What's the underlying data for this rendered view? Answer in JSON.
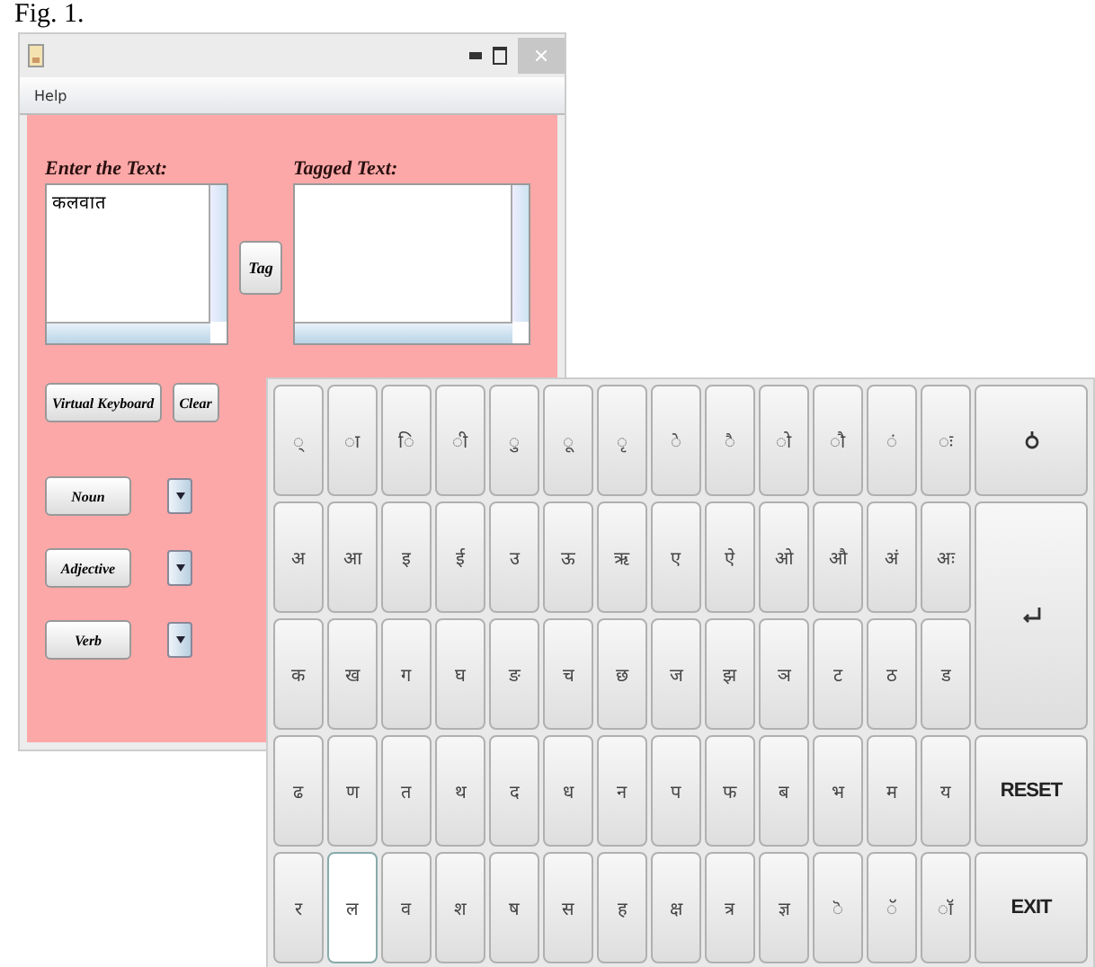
{
  "caption": "Fig. 1.",
  "window": {
    "menu": [
      "Help"
    ]
  },
  "input_label": "Enter the Text:",
  "input_value": "कलवात",
  "output_label": "Tagged Text:",
  "tag_button": "Tag",
  "buttons": [
    "Virtual Keyboard",
    "Clear"
  ],
  "tag_rows": [
    {
      "label": "Noun"
    },
    {
      "label": "Adjective"
    },
    {
      "label": "Verb"
    }
  ],
  "keyboard": {
    "rows": [
      [
        {
          "label": "्",
          "selected": false
        },
        {
          "label": "ा",
          "selected": false
        },
        {
          "label": "ि",
          "selected": false
        },
        {
          "label": "ी",
          "selected": false
        },
        {
          "label": "ु",
          "selected": false
        },
        {
          "label": "ू",
          "selected": false
        },
        {
          "label": "ृ",
          "selected": false
        },
        {
          "label": "े",
          "selected": false
        },
        {
          "label": "ै",
          "selected": false
        },
        {
          "label": "ो",
          "selected": false
        },
        {
          "label": "ौ",
          "selected": false
        },
        {
          "label": "ं",
          "selected": false
        },
        {
          "label": "ः",
          "selected": false
        }
      ],
      [
        {
          "label": "अ",
          "selected": false
        },
        {
          "label": "आ",
          "selected": false
        },
        {
          "label": "इ",
          "selected": false
        },
        {
          "label": "ई",
          "selected": false
        },
        {
          "label": "उ",
          "selected": false
        },
        {
          "label": "ऊ",
          "selected": false
        },
        {
          "label": "ऋ",
          "selected": false
        },
        {
          "label": "ए",
          "selected": false
        },
        {
          "label": "ऐ",
          "selected": false
        },
        {
          "label": "ओ",
          "selected": false
        },
        {
          "label": "औ",
          "selected": false
        },
        {
          "label": "अं",
          "selected": false
        },
        {
          "label": "अः",
          "selected": false
        }
      ],
      [
        {
          "label": "क",
          "selected": false
        },
        {
          "label": "ख",
          "selected": false
        },
        {
          "label": "ग",
          "selected": false
        },
        {
          "label": "घ",
          "selected": false
        },
        {
          "label": "ङ",
          "selected": false
        },
        {
          "label": "च",
          "selected": false
        },
        {
          "label": "छ",
          "selected": false
        },
        {
          "label": "ज",
          "selected": false
        },
        {
          "label": "झ",
          "selected": false
        },
        {
          "label": "ञ",
          "selected": false
        },
        {
          "label": "ट",
          "selected": false
        },
        {
          "label": "ठ",
          "selected": false
        },
        {
          "label": "ड",
          "selected": false
        }
      ],
      [
        {
          "label": "ढ",
          "selected": false
        },
        {
          "label": "ण",
          "selected": false
        },
        {
          "label": "त",
          "selected": false
        },
        {
          "label": "थ",
          "selected": false
        },
        {
          "label": "द",
          "selected": false
        },
        {
          "label": "ध",
          "selected": false
        },
        {
          "label": "न",
          "selected": false
        },
        {
          "label": "प",
          "selected": false
        },
        {
          "label": "फ",
          "selected": false
        },
        {
          "label": "ब",
          "selected": false
        },
        {
          "label": "भ",
          "selected": false
        },
        {
          "label": "म",
          "selected": false
        },
        {
          "label": "य",
          "selected": false
        }
      ],
      [
        {
          "label": "र",
          "selected": false
        },
        {
          "label": "ल",
          "selected": true
        },
        {
          "label": "व",
          "selected": false
        },
        {
          "label": "श",
          "selected": false
        },
        {
          "label": "ष",
          "selected": false
        },
        {
          "label": "स",
          "selected": false
        },
        {
          "label": "ह",
          "selected": false
        },
        {
          "label": "क्ष",
          "selected": false
        },
        {
          "label": "त्र",
          "selected": false
        },
        {
          "label": "ज्ञ",
          "selected": false
        },
        {
          "label": "ॆ",
          "selected": false
        },
        {
          "label": "ॅ",
          "selected": false
        },
        {
          "label": "ॉ",
          "selected": false
        }
      ]
    ],
    "side_keys": [
      {
        "kind": "symbol"
      },
      {
        "kind": "enter"
      },
      {
        "kind": "text",
        "label": "RESET"
      },
      {
        "kind": "text",
        "label": "EXIT"
      }
    ]
  }
}
